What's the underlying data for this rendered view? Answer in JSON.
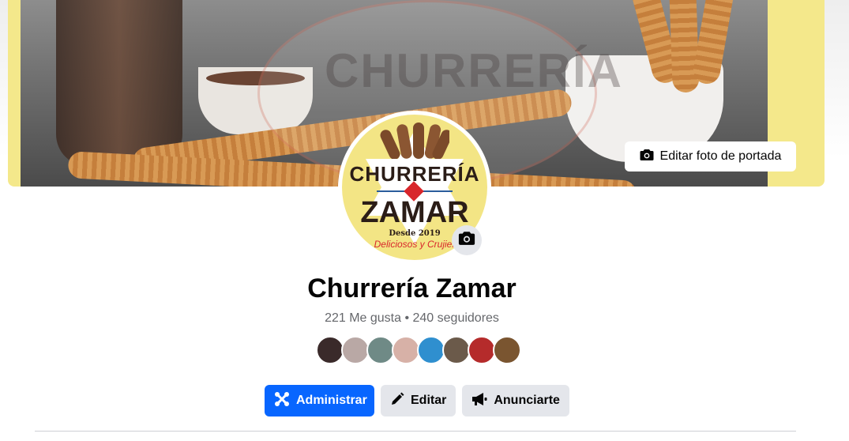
{
  "cover": {
    "edit_cover_label": "Editar foto de portada",
    "watermark_text": "CHURRERÍA"
  },
  "logo": {
    "line1": "CHURRERÍA",
    "line2": "ZAMAR",
    "line3": "Desde 2019",
    "line4": "Deliciosos y Crujier"
  },
  "page": {
    "name": "Churrería Zamar",
    "stats": "221 Me gusta • 240 seguidores"
  },
  "followers": {
    "avatar_colors": [
      "#3a2a2a",
      "#b9a8a5",
      "#6f8a86",
      "#d7b1a7",
      "#2f8fcf",
      "#6b5a4a",
      "#b52b2b",
      "#7a5530"
    ]
  },
  "actions": {
    "manage_label": "Administrar",
    "edit_label": "Editar",
    "advertise_label": "Anunciarte"
  },
  "colors": {
    "primary": "#0866ff",
    "secondary_bg": "#e4e6eb",
    "text": "#050505",
    "muted": "#65676b",
    "cover_side": "#f4e88b"
  },
  "icons": {
    "camera": "camera-icon",
    "manage": "manage-icon",
    "edit": "pencil-icon",
    "advertise": "megaphone-icon"
  }
}
